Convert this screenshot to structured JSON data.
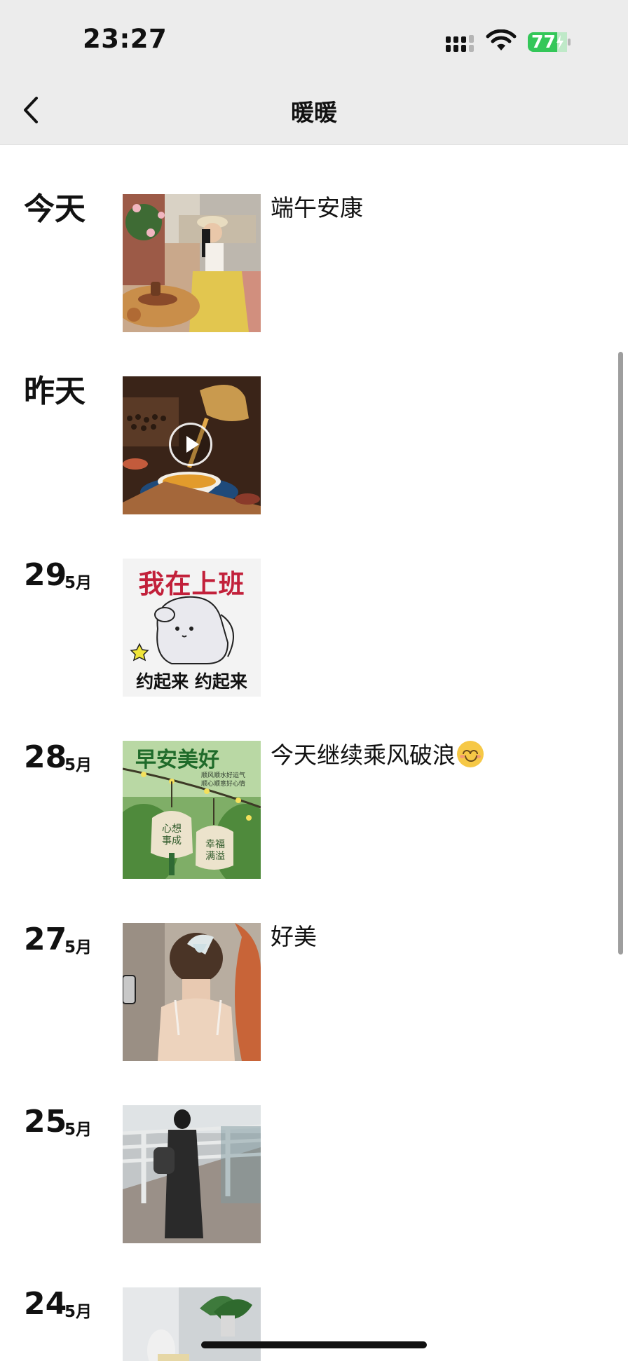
{
  "status_bar": {
    "time": "23:27",
    "battery": "77",
    "icons": [
      "signal-icon",
      "wifi-icon",
      "battery-icon"
    ]
  },
  "nav": {
    "title": "暖暖",
    "back_icon": "chevron-left-icon"
  },
  "entries": [
    {
      "date_word": "今天",
      "caption": "端午安康",
      "media": "photo",
      "thumb_desc_icon": "image-thumbnail"
    },
    {
      "date_word": "昨天",
      "caption": "",
      "media": "video",
      "thumb_desc_icon": "video-thumbnail"
    },
    {
      "day": "29",
      "month": "5月",
      "caption": "",
      "media": "photo",
      "thumb_text_top": "我在上班",
      "thumb_text_bottom": "约起来 约起来"
    },
    {
      "day": "28",
      "month": "5月",
      "caption": "今天继续乘风破浪",
      "media": "photo",
      "thumb_text_top": "早安美好",
      "thumb_text_small_1": "顺风顺水好运气",
      "thumb_text_small_2": "顺心顺意好心情",
      "thumb_text_bag_1": "心想 事成",
      "thumb_text_bag_2": "幸福 满溢"
    },
    {
      "day": "27",
      "month": "5月",
      "caption": "好美",
      "media": "photo"
    },
    {
      "day": "25",
      "month": "5月",
      "caption": "",
      "media": "photo"
    },
    {
      "day": "24",
      "month": "5月",
      "caption": "",
      "media": "photo"
    }
  ],
  "colors": {
    "header_bg": "#ececec",
    "battery_green": "#34c759",
    "text": "#111111"
  }
}
